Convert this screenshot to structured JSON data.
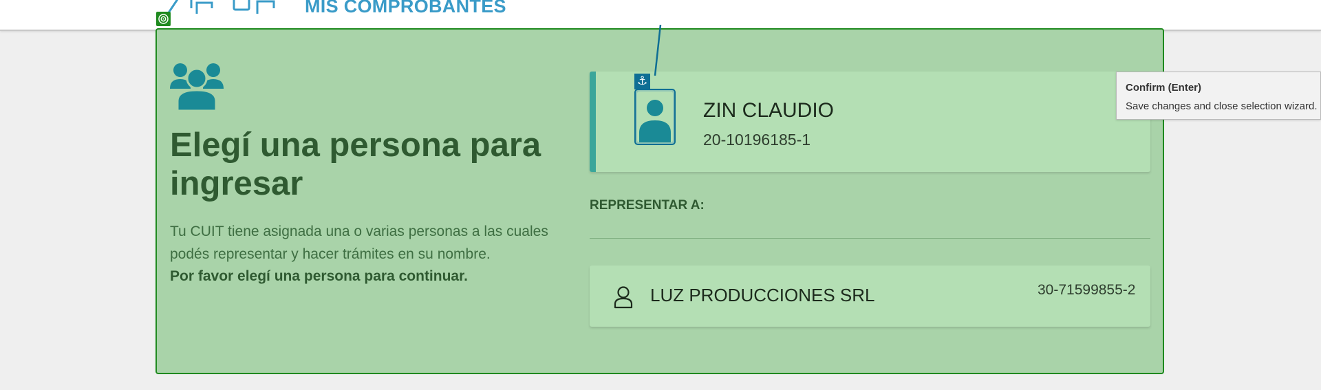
{
  "header": {
    "app_title": "MIS COMPROBANTES",
    "logo_icon": "afip-logo"
  },
  "intro": {
    "icon": "users-group-icon",
    "heading": "Elegí una persona para ingresar",
    "description": "Tu CUIT tiene asignada una o varias personas a las cuales podés representar y hacer trámites en su nombre.",
    "description_strong": "Por favor elegí una persona para continuar."
  },
  "current_user": {
    "name": "ZIN CLAUDIO",
    "cuit": "20-10196185-1",
    "icon": "person-avatar-icon"
  },
  "represent": {
    "label": "REPRESENTAR A:",
    "options": [
      {
        "name": "LUZ PRODUCCIONES SRL",
        "cuit": "30-71599855-2",
        "icon": "user-outline-icon"
      }
    ]
  },
  "tooltip": {
    "title": "Confirm (Enter)",
    "text": "Save changes and close selection wizard."
  },
  "colors": {
    "panel_bg": "#a9d3a9",
    "panel_border": "#1f8a1f",
    "card_bg": "#b4dfb4",
    "accent": "#3aa69a",
    "teal_icon": "#1a8a96",
    "heading": "#2f5a31",
    "title_blue": "#3a9bc8"
  }
}
